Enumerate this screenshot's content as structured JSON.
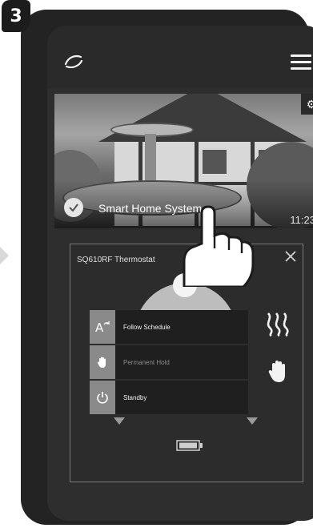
{
  "step": {
    "number": "3"
  },
  "header": {
    "logo_icon": "s-logo-icon",
    "menu_icon": "hamburger-menu-icon"
  },
  "banner": {
    "system_name": "Smart Home System",
    "time": "11:23",
    "settings_icon": "gear-icon",
    "status_icon": "check-circle-icon"
  },
  "thermostat": {
    "title": "SQ610RF Thermostat",
    "close_icon": "close-icon",
    "heating_icon": "heat-waves-icon",
    "mode_indicator_icon": "hand-icon",
    "battery_icon": "battery-icon"
  },
  "mode_menu": {
    "items": [
      {
        "label": "Follow Schedule",
        "icon": "auto-schedule-icon",
        "highlighted": true
      },
      {
        "label": "Permanent Hold",
        "icon": "hand-icon",
        "highlighted": false
      },
      {
        "label": "Standby",
        "icon": "power-icon",
        "highlighted": true
      }
    ]
  }
}
